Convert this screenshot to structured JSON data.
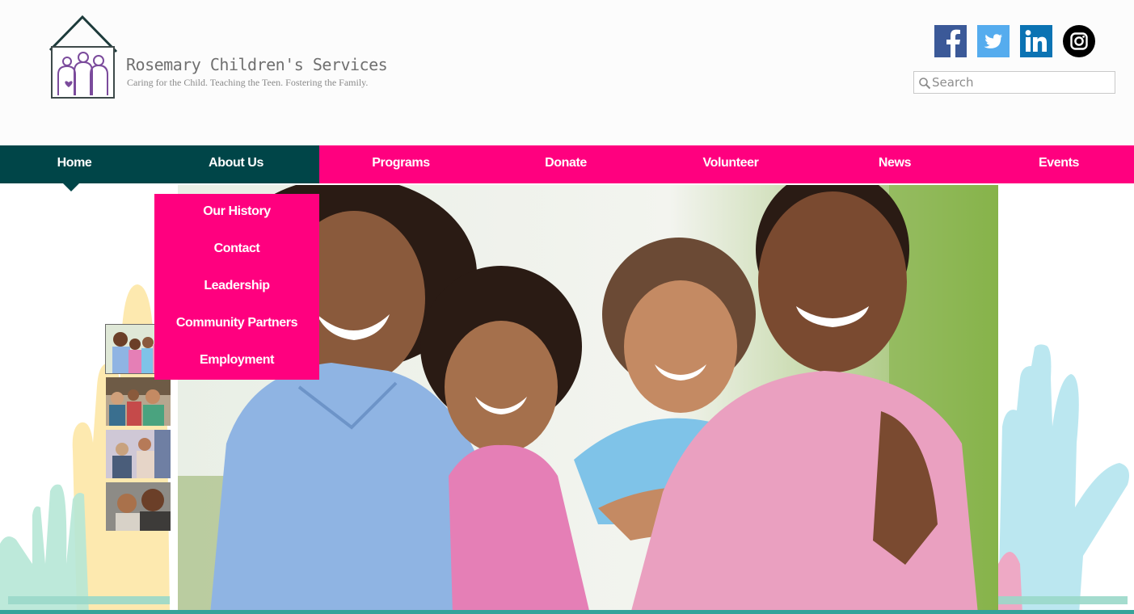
{
  "header": {
    "brand_name": "Rosemary Children's Services",
    "tagline": "Caring for the Child. Teaching the Teen. Fostering the Family."
  },
  "social": {
    "items": [
      {
        "icon": "facebook-icon",
        "color": "#3b5998"
      },
      {
        "icon": "twitter-icon",
        "color": "#55acee"
      },
      {
        "icon": "linkedin-icon",
        "color": "#0b73b3"
      },
      {
        "icon": "instagram-icon",
        "color": "#000000"
      }
    ]
  },
  "search": {
    "placeholder": "Search",
    "value": ""
  },
  "nav": {
    "items": [
      {
        "label": "Home",
        "active": true
      },
      {
        "label": "About Us",
        "hover": true
      },
      {
        "label": "Programs"
      },
      {
        "label": "Donate"
      },
      {
        "label": "Volunteer"
      },
      {
        "label": "News"
      },
      {
        "label": "Events"
      }
    ]
  },
  "dropdown": {
    "items": [
      {
        "label": "Our History"
      },
      {
        "label": "Contact"
      },
      {
        "label": "Leadership"
      },
      {
        "label": "Community Partners"
      },
      {
        "label": "Employment"
      }
    ]
  },
  "colors": {
    "brand_pink": "#ff007f",
    "brand_teal_dark": "#004548",
    "logo_purple": "#7b4b9c"
  }
}
